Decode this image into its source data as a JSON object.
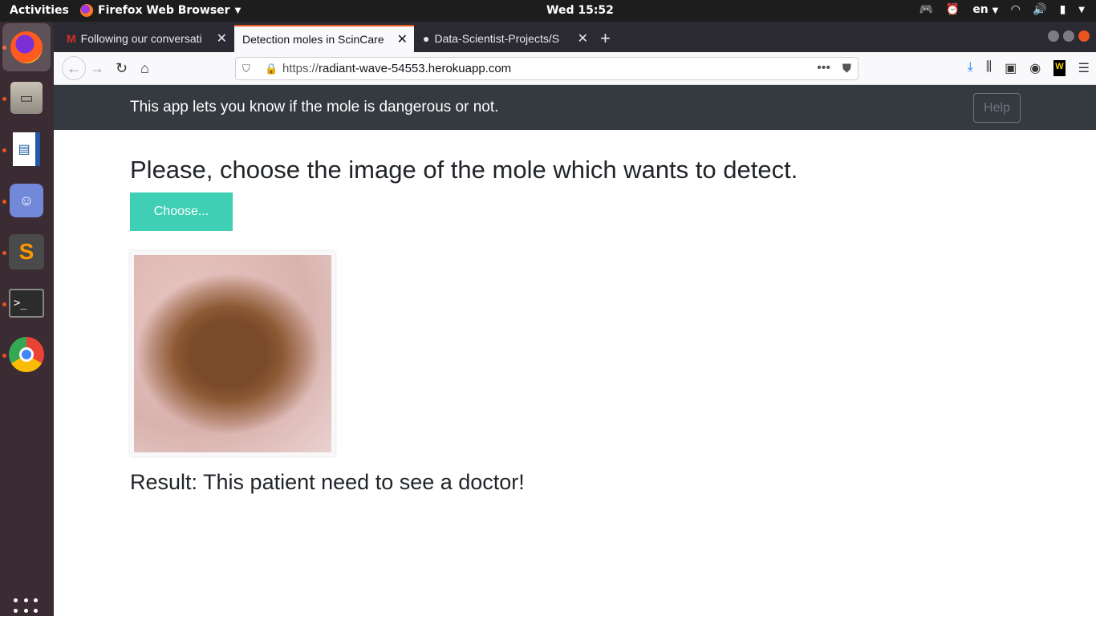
{
  "topbar": {
    "activities": "Activities",
    "app_name": "Firefox Web Browser",
    "clock": "Wed 15:52",
    "language": "en"
  },
  "dock": {
    "items": [
      "firefox",
      "files",
      "libreoffice-impress",
      "discord",
      "sublime-text",
      "terminal",
      "chrome"
    ]
  },
  "browser": {
    "tabs": [
      {
        "label": "Following our conversati",
        "active": false
      },
      {
        "label": "Detection moles in ScinCare",
        "active": true
      },
      {
        "label": "Data-Scientist-Projects/S",
        "active": false
      }
    ],
    "url_prefix": "https://",
    "url_host": "radiant-wave-54553.herokuapp.com"
  },
  "app": {
    "tagline": "This app lets you know if the mole is dangerous or not.",
    "help_label": "Help",
    "headline": "Please, choose the image of the mole which wants to detect.",
    "choose_label": "Choose...",
    "result": "Result: This patient need to see a doctor!"
  },
  "colors": {
    "header_bg": "#343a40",
    "choose_bg": "#3ecfb4",
    "tab_accent": "#e95420"
  }
}
